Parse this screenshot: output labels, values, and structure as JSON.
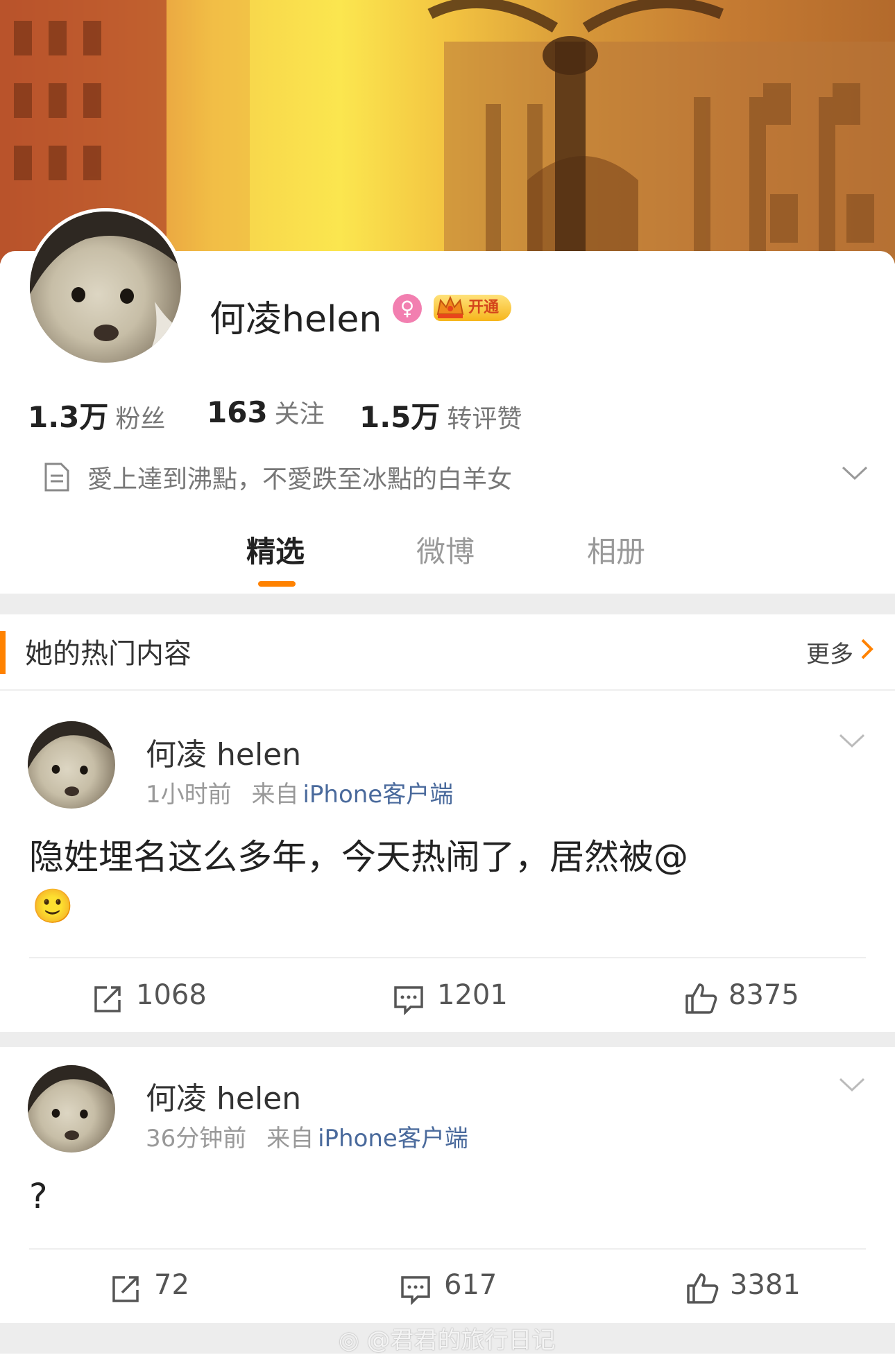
{
  "profile": {
    "username": "何凌helen",
    "vip_label": "开通",
    "stats": [
      {
        "num": "1.3万",
        "label": "粉丝"
      },
      {
        "num": "163",
        "label": "关注"
      },
      {
        "num": "1.5万",
        "label": "转评赞"
      }
    ],
    "bio": "愛上達到沸點，不愛跌至冰點的白羊女"
  },
  "tabs": [
    {
      "label": "精选",
      "active": true
    },
    {
      "label": "微博",
      "active": false
    },
    {
      "label": "相册",
      "active": false
    }
  ],
  "hot": {
    "title": "她的热门内容",
    "more": "更多"
  },
  "posts": [
    {
      "name": "何凌 helen",
      "time": "1小时前",
      "from": "来自",
      "source": "iPhone客户端",
      "text": "隐姓埋名这么多年，今天热闹了，居然被@",
      "emoji": "🙂",
      "reposts": "1068",
      "comments": "1201",
      "likes": "8375"
    },
    {
      "name": "何凌 helen",
      "time": "36分钟前",
      "from": "来自",
      "source": "iPhone客户端",
      "text": "?",
      "reposts": "72",
      "comments": "617",
      "likes": "3381"
    }
  ],
  "watermark": "@君君的旅行日记",
  "colors": {
    "accent": "#ff8200",
    "source_link": "#4a6a9c"
  }
}
